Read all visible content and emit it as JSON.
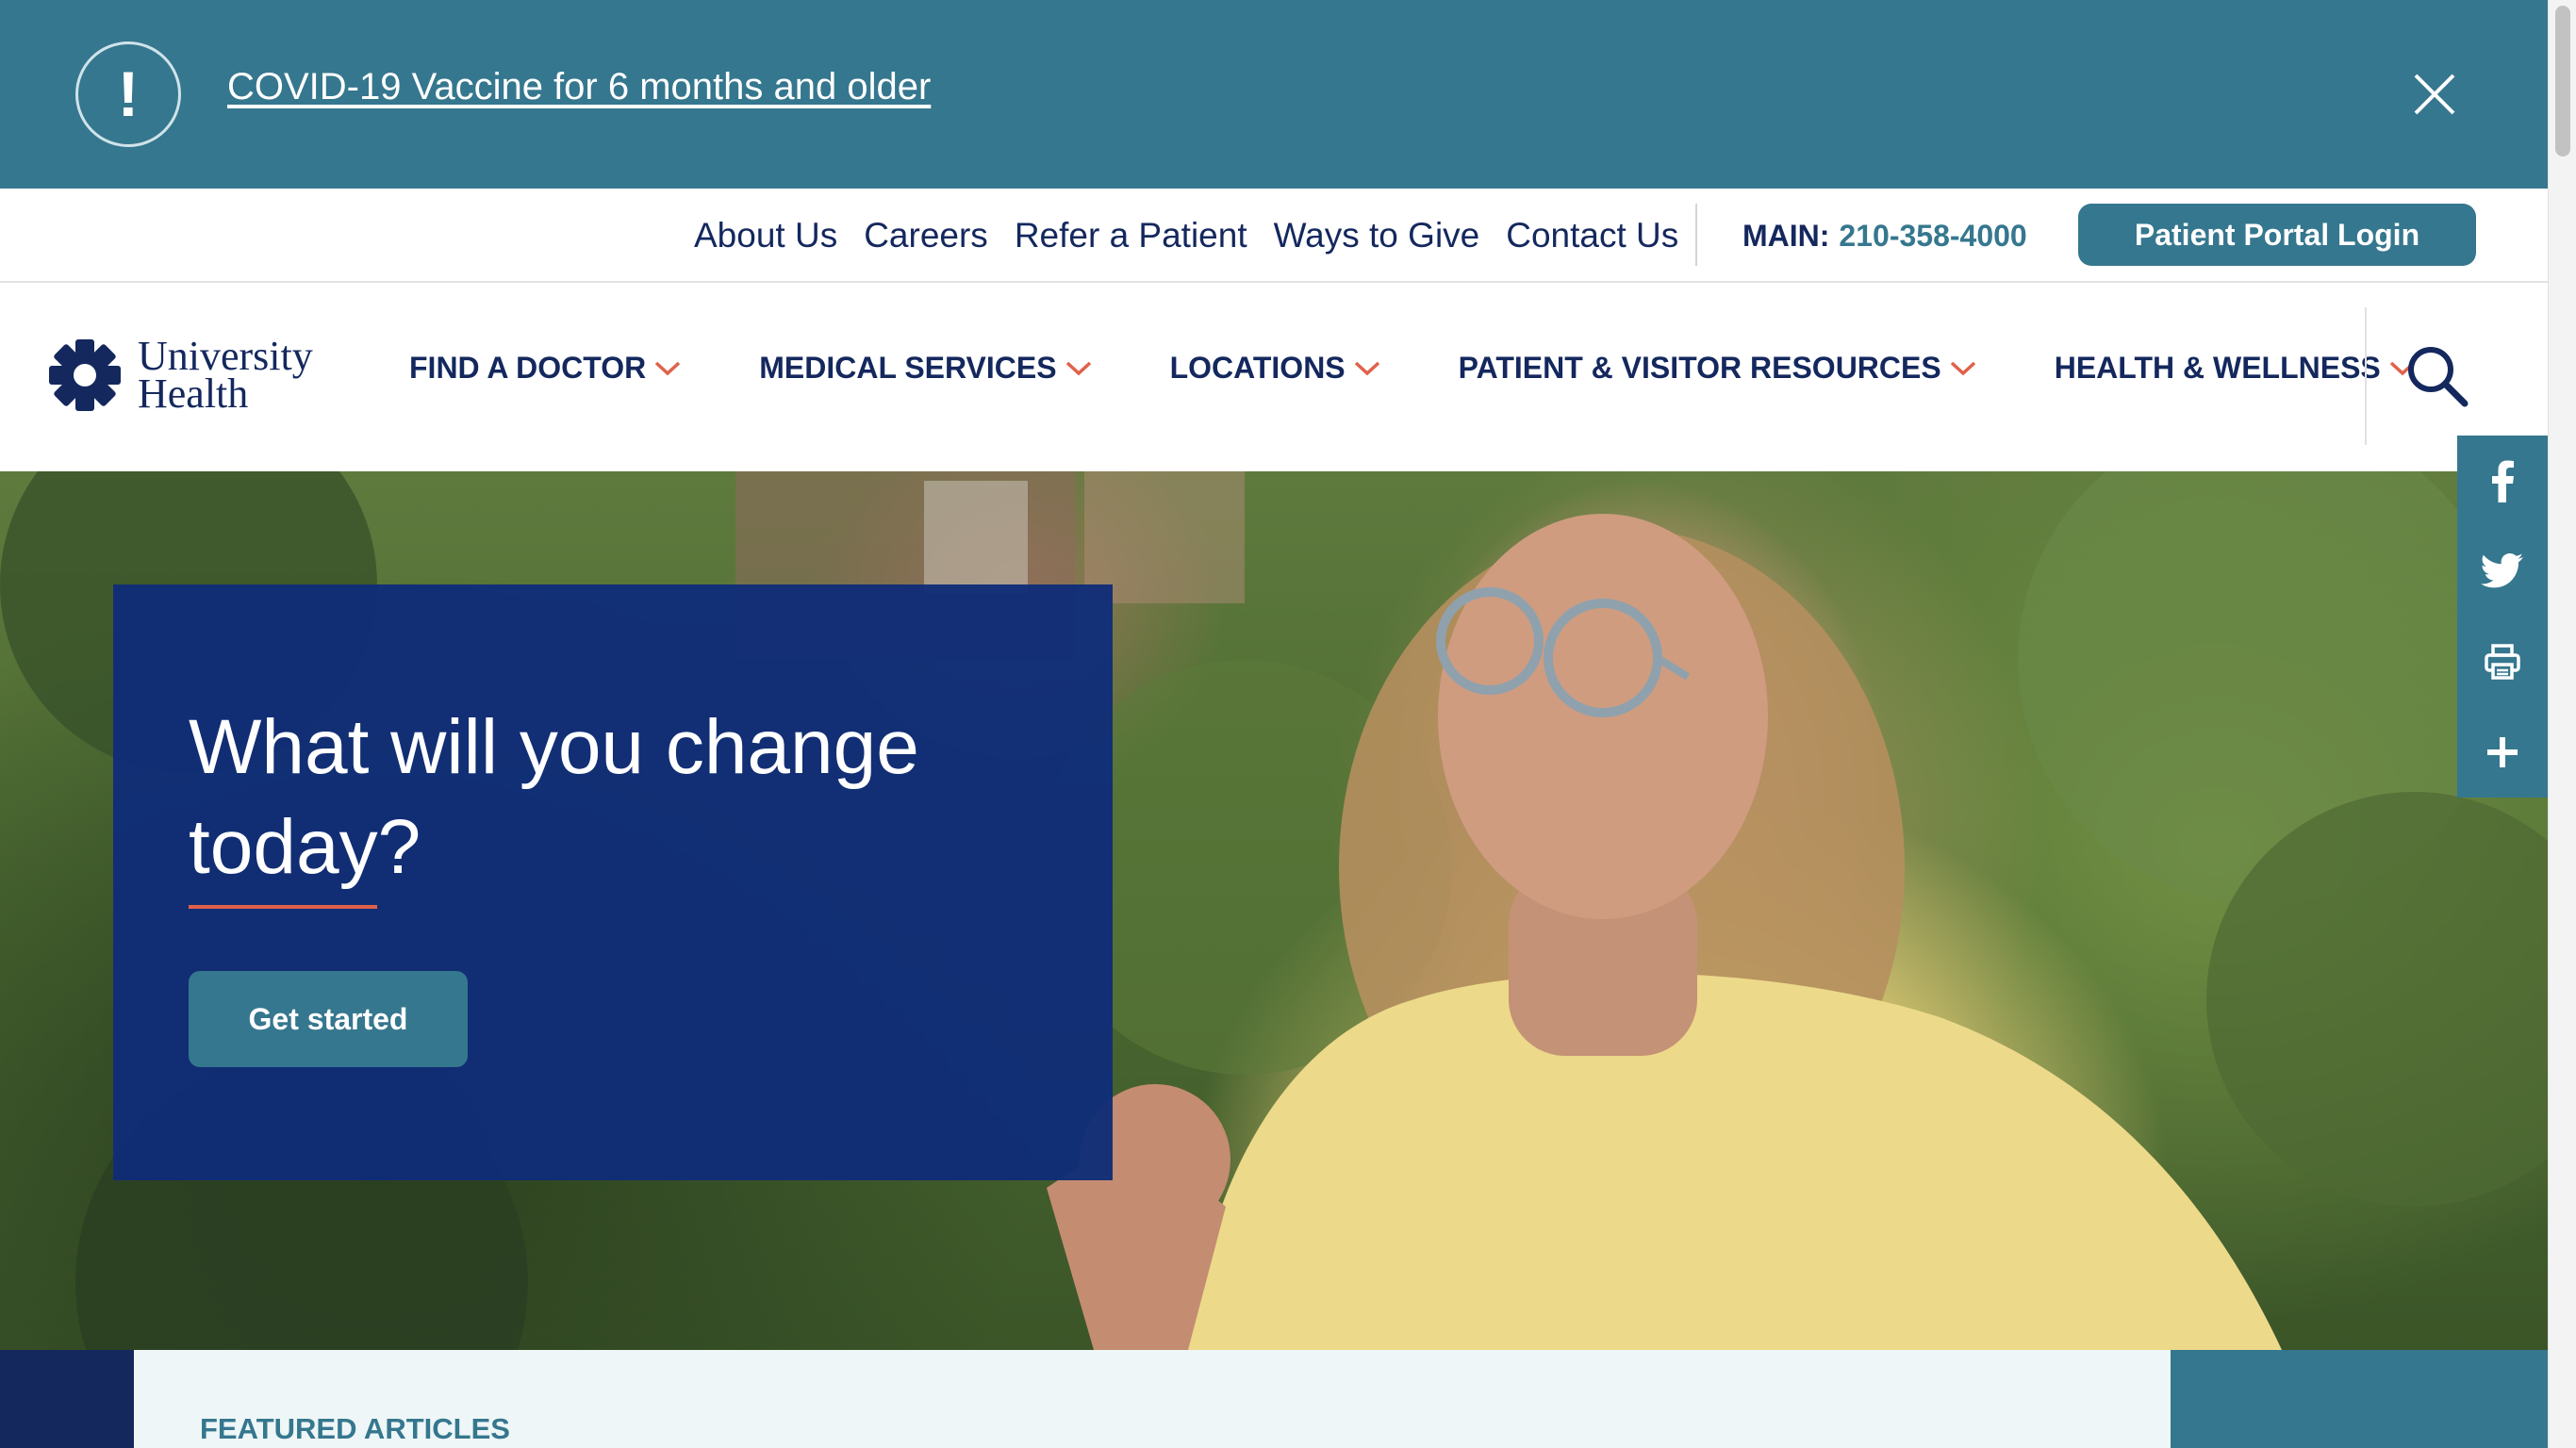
{
  "alert": {
    "icon": "alert-exclamation-icon",
    "icon_glyph": "!",
    "link_text": "COVID-19 Vaccine for 6 months and older",
    "close_icon": "close-icon"
  },
  "utility_nav": {
    "links": [
      "About Us",
      "Careers",
      "Refer a Patient",
      "Ways to Give",
      "Contact Us"
    ],
    "main_label": "MAIN:",
    "main_phone": "210-358-4000",
    "portal_button": "Patient Portal Login"
  },
  "brand": {
    "line1": "University",
    "line2": "Health"
  },
  "main_nav": {
    "items": [
      "FIND A DOCTOR",
      "MEDICAL SERVICES",
      "LOCATIONS",
      "PATIENT & VISITOR RESOURCES",
      "HEALTH & WELLNESS"
    ],
    "search_icon": "search-icon"
  },
  "hero": {
    "title": "What will you change today?",
    "cta": "Get started"
  },
  "social": [
    "facebook-icon",
    "twitter-icon",
    "print-icon",
    "plus-icon"
  ],
  "featured": {
    "label": "FEATURED ARTICLES"
  },
  "colors": {
    "teal": "#35778e",
    "navy": "#14285e",
    "accent": "#e0614a",
    "light_bg": "#eef6f7"
  }
}
